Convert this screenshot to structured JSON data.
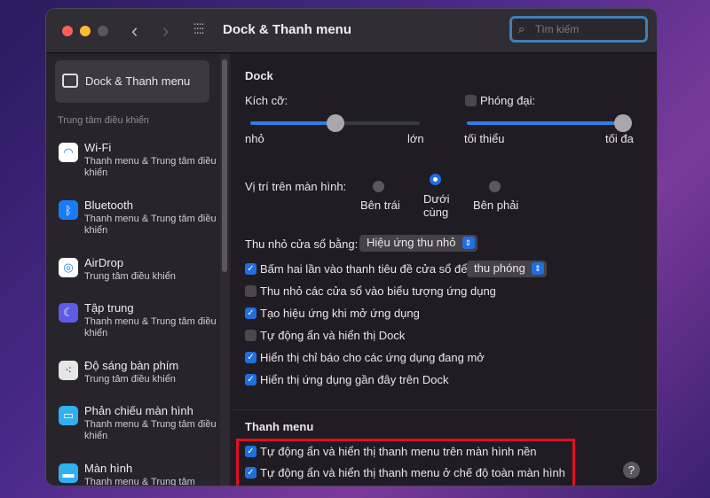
{
  "window": {
    "title": "Dock & Thanh menu",
    "search_placeholder": "Tìm kiếm"
  },
  "sidebar": {
    "selected": "Dock & Thanh menu",
    "group": "Trung tâm điều khiển",
    "items": [
      {
        "name": "Wi-Fi",
        "sub": "Thanh menu & Trung tâm điều khiển",
        "icon": "wifi-icon",
        "color": "#ffffff"
      },
      {
        "name": "Bluetooth",
        "sub": "Thanh menu & Trung tâm điều khiển",
        "icon": "bluetooth-icon",
        "color": "#1a7cf5"
      },
      {
        "name": "AirDrop",
        "sub": "Trung tâm điều khiển",
        "icon": "airdrop-icon",
        "color": "#ffffff"
      },
      {
        "name": "Tập trung",
        "sub": "Thanh menu & Trung tâm điều khiển",
        "icon": "moon-icon",
        "color": "#5e5ce6"
      },
      {
        "name": "Độ sáng bàn phím",
        "sub": "Trung tâm điều khiển",
        "icon": "keyboard-brightness-icon",
        "color": "#e5e5e5"
      },
      {
        "name": "Phản chiếu màn hình",
        "sub": "Thanh menu & Trung tâm điều khiển",
        "icon": "screen-mirroring-icon",
        "color": "#30b0f0"
      },
      {
        "name": "Màn hình",
        "sub": "Thanh menu & Trung tâm",
        "icon": "display-icon",
        "color": "#30b0f0"
      }
    ]
  },
  "dock": {
    "heading": "Dock",
    "size_label": "Kích cỡ:",
    "size_min": "nhỏ",
    "size_max": "lớn",
    "size_value": 0.5,
    "magnify_label": "Phóng đại:",
    "magnify_checked": false,
    "magnify_min": "tối thiểu",
    "magnify_max": "tối đa",
    "magnify_value": 1.0,
    "position_label": "Vị trí trên màn hình:",
    "positions": [
      "Bên trái",
      "Dưới cùng",
      "Bên phải"
    ],
    "position_selected": "Dưới cùng",
    "minimize_label": "Thu nhỏ cửa sổ bằng:",
    "minimize_value": "Hiệu ứng thu nhỏ",
    "dblclick_label": "Bấm hai lần vào thanh tiêu đề cửa sổ để",
    "dblclick_value": "thu phóng",
    "options": [
      {
        "label": "Thu nhỏ các cửa sổ vào biểu tượng ứng dụng",
        "checked": false
      },
      {
        "label": "Tạo hiệu ứng khi mở ứng dụng",
        "checked": true
      },
      {
        "label": "Tự động ẩn và hiển thị Dock",
        "checked": false
      },
      {
        "label": "Hiển thị chỉ báo cho các ứng dụng đang mở",
        "checked": true
      },
      {
        "label": "Hiển thị ứng dụng gần đây trên Dock",
        "checked": true
      }
    ]
  },
  "menubar": {
    "heading": "Thanh menu",
    "options": [
      {
        "label": "Tự động ẩn và hiển thị thanh menu trên màn hình nền",
        "checked": true
      },
      {
        "label": "Tự động ẩn và hiển thị thanh menu ở chế độ toàn màn hình",
        "checked": true
      }
    ]
  },
  "help": "?"
}
